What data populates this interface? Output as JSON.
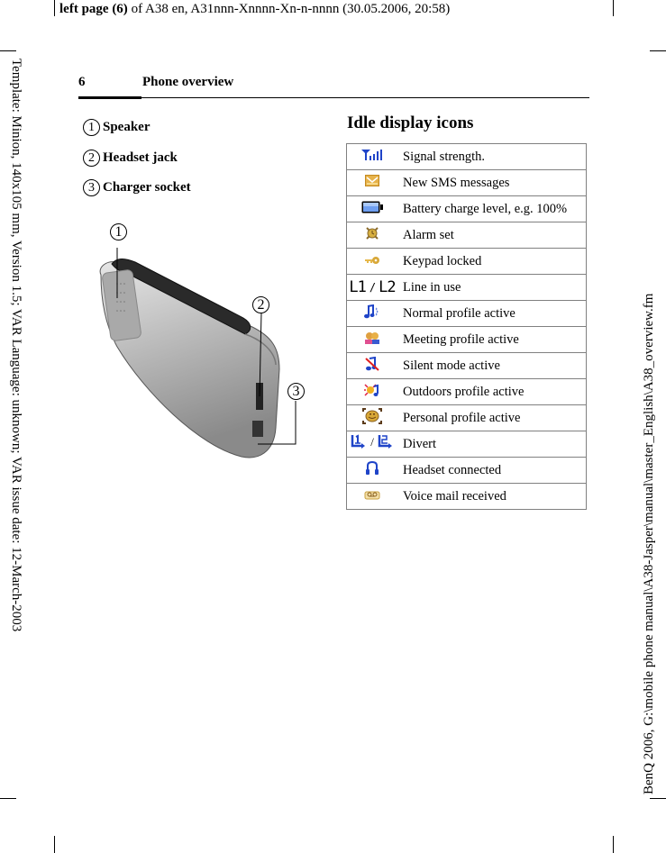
{
  "slug": {
    "bold_part": "left page (6)",
    "rest": " of A38 en, A31nnn-Xnnnn-Xn-n-nnnn (30.05.2006, 20:58)"
  },
  "side_left_text": "Template: Minion, 140x105 mm, Version 1.5; VAR Language: unknown; VAR issue date: 12-March-2003",
  "side_right_text": "BenQ 2006, G:\\mobile phone manual\\A38-Jasper\\manual\\master_English\\A38_overview.fm",
  "header": {
    "page_number": "6",
    "title": "Phone overview"
  },
  "legend": [
    {
      "number": "1",
      "label": "Speaker"
    },
    {
      "number": "2",
      "label": "Headset jack"
    },
    {
      "number": "3",
      "label": "Charger socket"
    }
  ],
  "figure": {
    "callouts": [
      "1",
      "2",
      "3"
    ],
    "description": "Phone side view"
  },
  "icons_section": {
    "title": "Idle display icons",
    "rows": [
      {
        "icon": "signal-strength-icon",
        "text": "Signal strength."
      },
      {
        "icon": "sms-envelope-icon",
        "text": "New SMS messages"
      },
      {
        "icon": "battery-icon",
        "text": "Battery charge level, e.g. 100%"
      },
      {
        "icon": "alarm-icon",
        "text": "Alarm set"
      },
      {
        "icon": "key-icon",
        "text": "Keypad locked"
      },
      {
        "icon": "line-icon",
        "text": "Line in use",
        "symbols": [
          "L1",
          "/",
          "L2"
        ]
      },
      {
        "icon": "music-note-icon",
        "text": "Normal profile active"
      },
      {
        "icon": "meeting-people-icon",
        "text": "Meeting profile active"
      },
      {
        "icon": "silent-icon",
        "text": "Silent mode active"
      },
      {
        "icon": "outdoors-icon",
        "text": "Outdoors profile active"
      },
      {
        "icon": "personal-face-icon",
        "text": "Personal profile active"
      },
      {
        "icon": "divert-icon",
        "text": "Divert",
        "symbols": [
          "1",
          "/",
          "2"
        ]
      },
      {
        "icon": "headset-icon",
        "text": "Headset connected"
      },
      {
        "icon": "voicemail-icon",
        "text": "Voice mail received"
      }
    ]
  },
  "colors": {
    "icon_blue": "#1f44c8",
    "icon_gold": "#d6a53a",
    "table_border": "#808080"
  }
}
